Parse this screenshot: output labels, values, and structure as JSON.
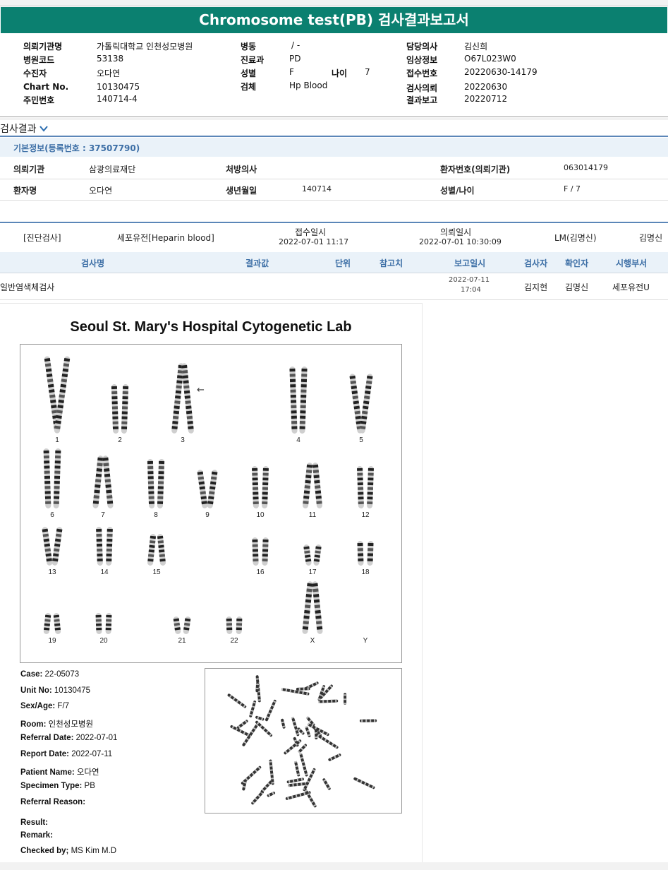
{
  "title": "Chromosome test(PB) 검사결과보고서",
  "header": {
    "col1": [
      {
        "label": "의뢰기관명",
        "value": "가톨릭대학교 인천성모병원"
      },
      {
        "label": "병원코드",
        "value": "53138"
      },
      {
        "label": "수진자",
        "value": "오다연"
      },
      {
        "label": "Chart No.",
        "value": "10130475"
      },
      {
        "label": "주민번호",
        "value": "140714-4"
      }
    ],
    "col2": [
      {
        "label": "병동",
        "value": "/ -"
      },
      {
        "label": "진료과",
        "value": "PD"
      },
      {
        "label": "성별",
        "value": "F"
      },
      {
        "label": "검체",
        "value": "Hp Blood"
      }
    ],
    "age_label": "나이",
    "age_value": "7",
    "col3": [
      {
        "label": "담당의사",
        "value": "김신희"
      },
      {
        "label": "임상정보",
        "value": "O67L023W0"
      },
      {
        "label": "접수번호",
        "value": "20220630-14179"
      },
      {
        "label": "검사의뢰",
        "value": "20220630"
      },
      {
        "label": "결과보고",
        "value": "20220712"
      }
    ]
  },
  "section_title": "검사결과",
  "basic_info_title": "기본정보(등록번호 : 37507790)",
  "basic_rows": {
    "r1": {
      "l1": "의뢰기관",
      "v1": "삼광의료재단",
      "l2": "처방의사",
      "v2": "",
      "l3": "환자번호(의뢰기관)",
      "v3": "063014179"
    },
    "r2": {
      "l1": "환자명",
      "v1": "오다연",
      "l2": "생년월일",
      "v2": "140714",
      "l3": "성별/나이",
      "v3": "F / 7"
    }
  },
  "exam": {
    "category": "[진단검사]",
    "test": "세포유전[Heparin blood]",
    "recv_label": "접수일시",
    "recv_value": "2022-07-01  11:17",
    "req_label": "의뢰일시",
    "req_value": "2022-07-01  10:30:09",
    "lm": "LM(김명신)",
    "doctor": "김명신"
  },
  "table": {
    "headers": [
      "검사명",
      "결과값",
      "단위",
      "참고치",
      "보고일시",
      "검사자",
      "확인자",
      "시행부서"
    ],
    "row": {
      "name": "일반염색체검사",
      "date": "2022-07-11",
      "time": "17:04",
      "tester": "김지현",
      "checker": "김명신",
      "dept": "세포유전U"
    }
  },
  "report": {
    "lab_title": "Seoul St. Mary's Hospital Cytogenetic Lab",
    "chrom_labels": [
      "1",
      "2",
      "3",
      "4",
      "5",
      "6",
      "7",
      "8",
      "9",
      "10",
      "11",
      "12",
      "13",
      "14",
      "15",
      "16",
      "17",
      "18",
      "19",
      "20",
      "21",
      "22",
      "X",
      "Y"
    ],
    "arrow_glyph": "←",
    "meta": [
      {
        "label": "Case:",
        "value": " 22-05073"
      },
      {
        "label": "Unit No:",
        "value": " 10130475"
      },
      {
        "label": "Sex/Age:",
        "value": " F/7"
      },
      {
        "label": "Room:",
        "value": " 인천성모병원"
      },
      {
        "label": "Referral Date:",
        "value": " 2022-07-01"
      },
      {
        "label": "Report Date:",
        "value": " 2022-07-11"
      },
      {
        "label": "Patient Name:",
        "value": " 오다연"
      },
      {
        "label": "Specimen Type:",
        "value": " PB"
      },
      {
        "label": "Referral Reason:",
        "value": ""
      }
    ],
    "result_label": "Result:",
    "remark_label": "Remark:",
    "checked_label": "Checked by;",
    "checked_value": " MS Kim M.D"
  }
}
